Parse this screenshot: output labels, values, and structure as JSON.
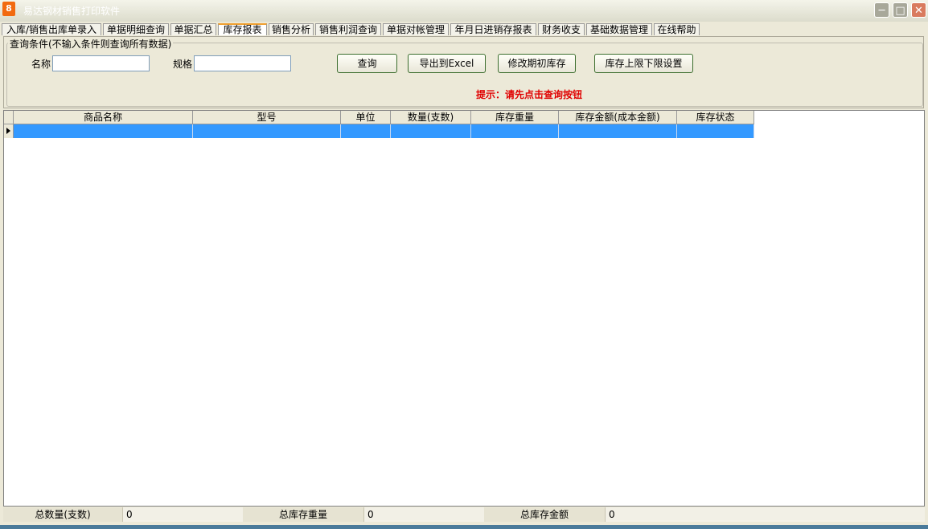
{
  "window": {
    "title": "易达钢材销售打印软件",
    "app_icon_glyph": "8"
  },
  "tabs": [
    {
      "label": "入库/销售出库单录入"
    },
    {
      "label": "单据明细查询"
    },
    {
      "label": "单据汇总"
    },
    {
      "label": "库存报表",
      "active": true
    },
    {
      "label": "销售分析"
    },
    {
      "label": "销售利润查询"
    },
    {
      "label": "单据对帐管理"
    },
    {
      "label": "年月日进销存报表"
    },
    {
      "label": "财务收支"
    },
    {
      "label": "基础数据管理"
    },
    {
      "label": "在线帮助"
    }
  ],
  "query": {
    "legend": "查询条件(不输入条件则查询所有数据)",
    "name_label": "名称",
    "name_value": "",
    "spec_label": "规格",
    "spec_value": "",
    "buttons": {
      "query": "查询",
      "export": "导出到Excel",
      "edit_initial": "修改期初库存",
      "limit_settings": "库存上限下限设置"
    },
    "hint": "提示：请先点击查询按钮"
  },
  "grid": {
    "columns": [
      "商品名称",
      "型号",
      "单位",
      "数量(支数)",
      "库存重量",
      "库存金额(成本金额)",
      "库存状态"
    ],
    "rows": [
      [
        "",
        "",
        "",
        "",
        "",
        "",
        ""
      ]
    ],
    "selected_row_color": "#3399ff"
  },
  "status": {
    "total_qty_label": "总数量(支数)",
    "total_qty_value": "0",
    "total_weight_label": "总库存重量",
    "total_weight_value": "0",
    "total_amount_label": "总库存金额",
    "total_amount_value": "0"
  }
}
